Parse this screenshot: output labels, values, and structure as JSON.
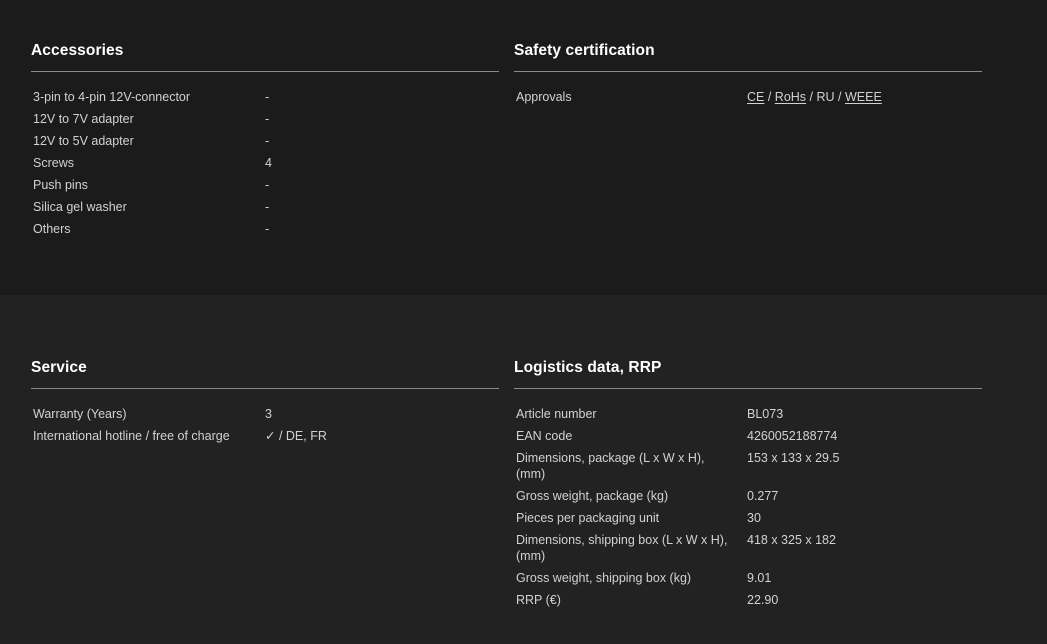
{
  "accessories": {
    "title": "Accessories",
    "rows": [
      {
        "label": "3-pin to 4-pin 12V-connector",
        "value": "-"
      },
      {
        "label": "12V to 7V adapter",
        "value": "-"
      },
      {
        "label": "12V to 5V adapter",
        "value": "-"
      },
      {
        "label": "Screws",
        "value": "4"
      },
      {
        "label": "Push pins",
        "value": "-"
      },
      {
        "label": "Silica gel washer",
        "value": "-"
      },
      {
        "label": "Others",
        "value": "-"
      }
    ]
  },
  "safety": {
    "title": "Safety certification",
    "approvals_label": "Approvals",
    "approvals": [
      "CE",
      "RoHs",
      "RU",
      "WEEE"
    ],
    "separator": " / "
  },
  "service": {
    "title": "Service",
    "rows": [
      {
        "label": "Warranty (Years)",
        "value": "3"
      },
      {
        "label": "International hotline / free of charge",
        "value": "✓ / DE, FR"
      }
    ]
  },
  "logistics": {
    "title": "Logistics data, RRP",
    "rows": [
      {
        "label": "Article number",
        "value": "BL073"
      },
      {
        "label": "EAN code",
        "value": "4260052188774"
      },
      {
        "label": "Dimensions, package (L x W x H), (mm)",
        "value": "153 x 133 x 29.5"
      },
      {
        "label": "Gross weight, package (kg)",
        "value": "0.277"
      },
      {
        "label": "Pieces per packaging unit",
        "value": "30"
      },
      {
        "label": "Dimensions, shipping box (L x W x H), (mm)",
        "value": "418 x 325 x 182"
      },
      {
        "label": "Gross weight, shipping box (kg)",
        "value": "9.01"
      },
      {
        "label": "RRP (€)",
        "value": "22.90"
      }
    ]
  }
}
